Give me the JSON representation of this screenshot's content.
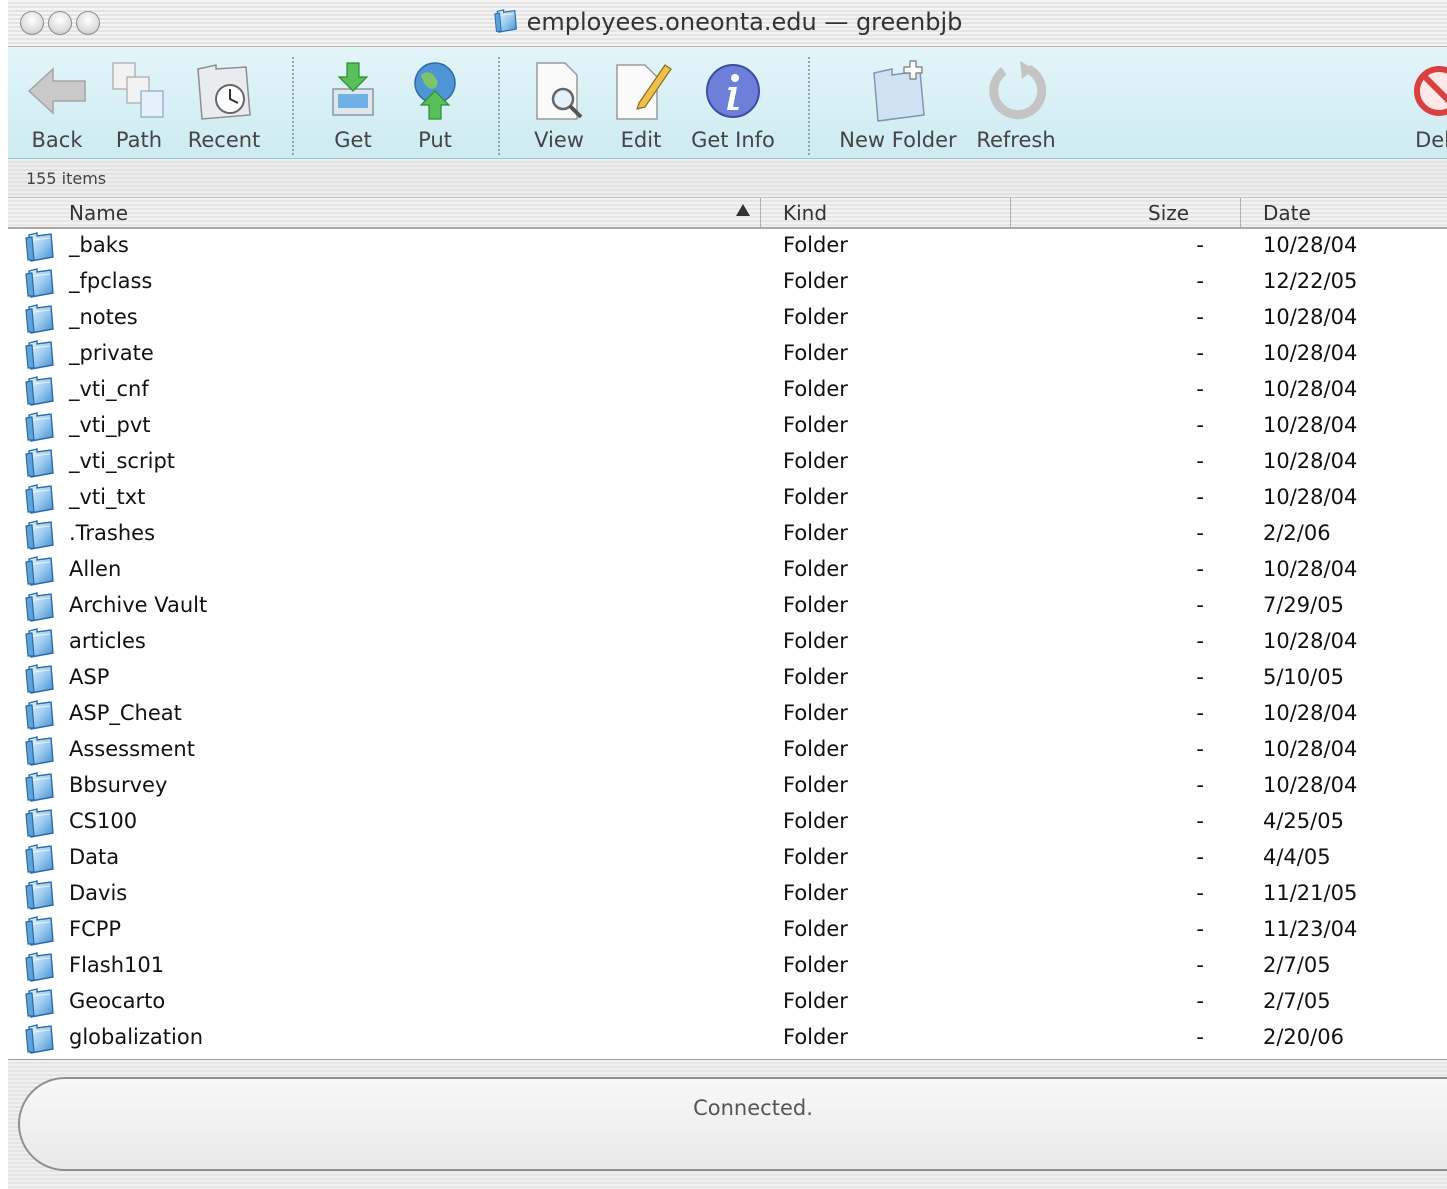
{
  "window": {
    "title": "employees.oneonta.edu — greenbjb"
  },
  "toolbar": {
    "buttons": [
      {
        "label": "Back",
        "icon": "back-arrow-icon"
      },
      {
        "label": "Path",
        "icon": "path-icon"
      },
      {
        "label": "Recent",
        "icon": "recent-clock-icon"
      },
      {
        "label": "Get",
        "icon": "download-icon"
      },
      {
        "label": "Put",
        "icon": "upload-globe-icon"
      },
      {
        "label": "View",
        "icon": "view-magnifier-icon"
      },
      {
        "label": "Edit",
        "icon": "edit-pencil-icon"
      },
      {
        "label": "Get Info",
        "icon": "info-icon"
      },
      {
        "label": "New Folder",
        "icon": "new-folder-icon"
      },
      {
        "label": "Refresh",
        "icon": "refresh-icon"
      },
      {
        "label": "Dele",
        "icon": "delete-icon"
      }
    ]
  },
  "status": {
    "items_count": "155 items",
    "connection": "Connected."
  },
  "columns": {
    "name": "Name",
    "kind": "Kind",
    "size": "Size",
    "date": "Date"
  },
  "files": [
    {
      "name": "_baks",
      "kind": "Folder",
      "size": "-",
      "date": "10/28/04"
    },
    {
      "name": "_fpclass",
      "kind": "Folder",
      "size": "-",
      "date": "12/22/05"
    },
    {
      "name": "_notes",
      "kind": "Folder",
      "size": "-",
      "date": "10/28/04"
    },
    {
      "name": "_private",
      "kind": "Folder",
      "size": "-",
      "date": "10/28/04"
    },
    {
      "name": "_vti_cnf",
      "kind": "Folder",
      "size": "-",
      "date": "10/28/04"
    },
    {
      "name": "_vti_pvt",
      "kind": "Folder",
      "size": "-",
      "date": "10/28/04"
    },
    {
      "name": "_vti_script",
      "kind": "Folder",
      "size": "-",
      "date": "10/28/04"
    },
    {
      "name": "_vti_txt",
      "kind": "Folder",
      "size": "-",
      "date": "10/28/04"
    },
    {
      "name": ".Trashes",
      "kind": "Folder",
      "size": "-",
      "date": "2/2/06"
    },
    {
      "name": "Allen",
      "kind": "Folder",
      "size": "-",
      "date": "10/28/04"
    },
    {
      "name": "Archive Vault",
      "kind": "Folder",
      "size": "-",
      "date": "7/29/05"
    },
    {
      "name": "articles",
      "kind": "Folder",
      "size": "-",
      "date": "10/28/04"
    },
    {
      "name": "ASP",
      "kind": "Folder",
      "size": "-",
      "date": "5/10/05"
    },
    {
      "name": "ASP_Cheat",
      "kind": "Folder",
      "size": "-",
      "date": "10/28/04"
    },
    {
      "name": "Assessment",
      "kind": "Folder",
      "size": "-",
      "date": "10/28/04"
    },
    {
      "name": "Bbsurvey",
      "kind": "Folder",
      "size": "-",
      "date": "10/28/04"
    },
    {
      "name": "CS100",
      "kind": "Folder",
      "size": "-",
      "date": "4/25/05"
    },
    {
      "name": "Data",
      "kind": "Folder",
      "size": "-",
      "date": "4/4/05"
    },
    {
      "name": "Davis",
      "kind": "Folder",
      "size": "-",
      "date": "11/21/05"
    },
    {
      "name": "FCPP",
      "kind": "Folder",
      "size": "-",
      "date": "11/23/04"
    },
    {
      "name": "Flash101",
      "kind": "Folder",
      "size": "-",
      "date": "2/7/05"
    },
    {
      "name": "Geocarto",
      "kind": "Folder",
      "size": "-",
      "date": "2/7/05"
    },
    {
      "name": "globalization",
      "kind": "Folder",
      "size": "-",
      "date": "2/20/06"
    }
  ]
}
